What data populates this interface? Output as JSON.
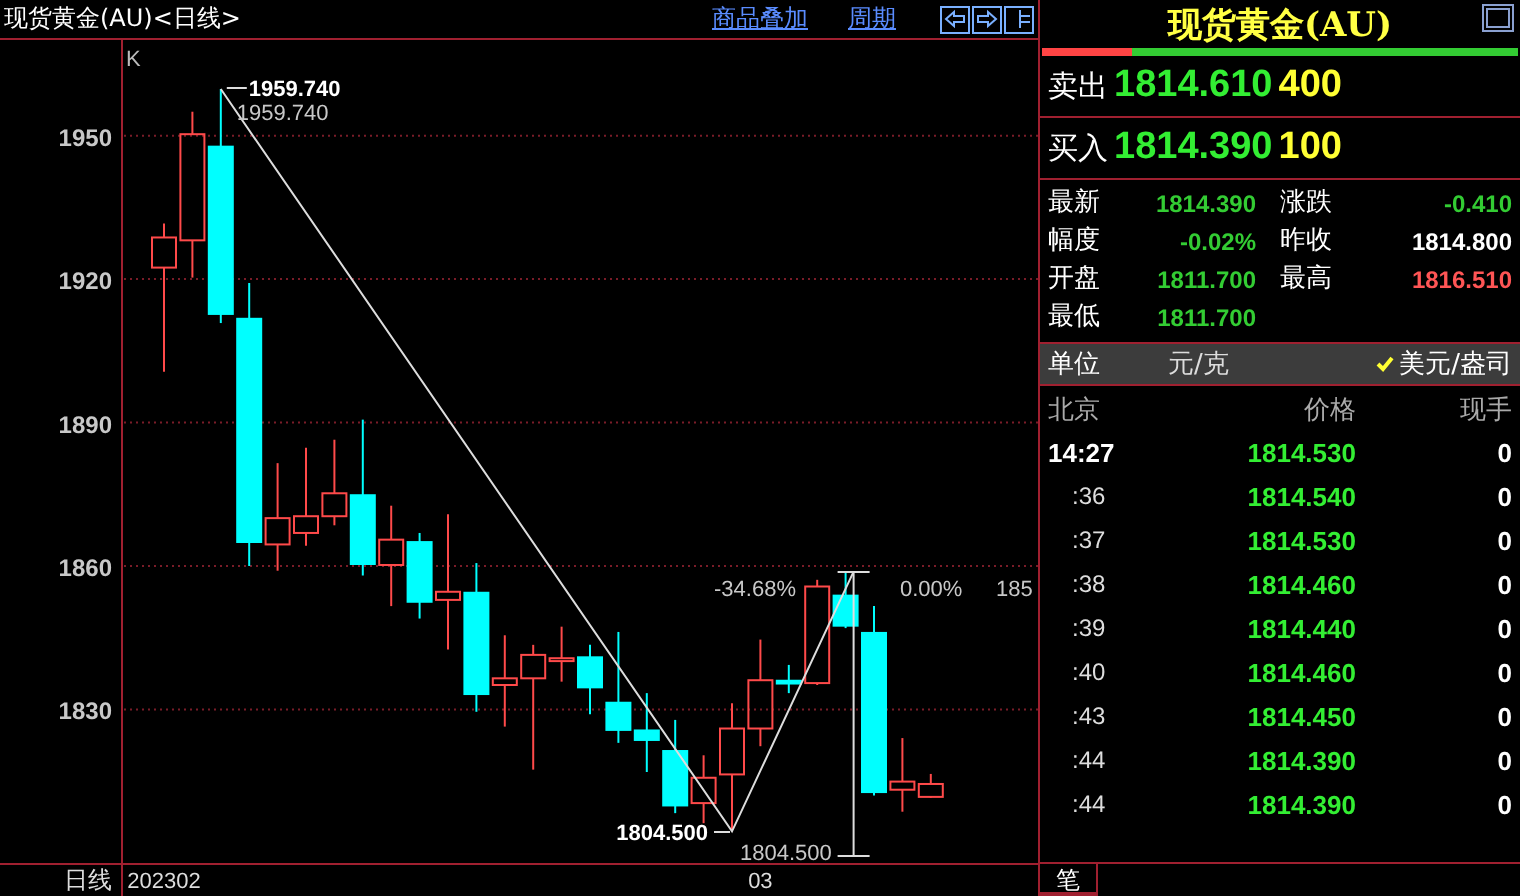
{
  "header": {
    "title": "现货黄金(AU)<日线>",
    "links": [
      "商品叠加",
      "周期"
    ]
  },
  "chart": {
    "corner_label": "K",
    "period_label": "日线",
    "chart_data": {
      "type": "candlestick",
      "ylim": [
        1798.5,
        1970
      ],
      "yticks": [
        1830,
        1860,
        1890,
        1920,
        1950
      ],
      "grid": true,
      "categories": [
        "202302",
        null,
        null,
        null,
        null,
        null,
        null,
        null,
        null,
        null,
        null,
        null,
        null,
        null,
        null,
        null,
        null,
        null,
        null,
        null,
        null,
        "03",
        null,
        null,
        null,
        null,
        null,
        null,
        null,
        null
      ],
      "ohlc": [
        [
          1922.4,
          1931.6,
          1900.6,
          1928.7
        ],
        [
          1928.1,
          1955,
          1920.3,
          1950.3
        ],
        [
          1947.9,
          1959.74,
          1910.8,
          1912.5
        ],
        [
          1911.9,
          1919.2,
          1860,
          1864.8
        ],
        [
          1864.5,
          1881.5,
          1859,
          1870
        ],
        [
          1866.9,
          1884.7,
          1864.2,
          1870.4
        ],
        [
          1870.4,
          1886.4,
          1868.5,
          1875.2
        ],
        [
          1875,
          1890.6,
          1858,
          1860.2
        ],
        [
          1860.2,
          1872.6,
          1851.6,
          1865.5
        ],
        [
          1865.2,
          1866.9,
          1849,
          1852.3
        ],
        [
          1852.9,
          1870.8,
          1842.5,
          1854.6
        ],
        [
          1854.6,
          1860.6,
          1829.5,
          1833
        ],
        [
          1835.1,
          1845.5,
          1826.4,
          1836.5
        ],
        [
          1836.5,
          1843.5,
          1817.4,
          1841.4
        ],
        [
          1840.1,
          1847.3,
          1835.8,
          1840.7
        ],
        [
          1841.1,
          1843.5,
          1829,
          1834.4
        ],
        [
          1831.6,
          1846.2,
          1823,
          1825.5
        ],
        [
          1825.8,
          1833.4,
          1816.9,
          1823.4
        ],
        [
          1821.5,
          1827.8,
          1808.3,
          1809.7
        ],
        [
          1810.4,
          1820.4,
          1806.2,
          1815.7
        ],
        [
          1816.4,
          1831.3,
          1804.5,
          1826
        ],
        [
          1826,
          1844.6,
          1822.3,
          1836.1
        ],
        [
          1836.2,
          1839.3,
          1833.4,
          1835.2
        ],
        [
          1835.5,
          1857.1,
          1835.1,
          1855.7
        ],
        [
          1854,
          1858.8,
          1847,
          1847.3
        ],
        [
          1846.2,
          1851.6,
          1812,
          1812.5
        ],
        [
          1813.2,
          1824,
          1808.6,
          1814.9
        ],
        [
          1811.7,
          1816.5,
          1811.5,
          1814.4
        ],
        null,
        null
      ],
      "annotations": [
        "1959.740",
        "1959.740",
        "1804.500",
        "1804.500",
        "-34.68%",
        "0.00%",
        "185"
      ]
    }
  },
  "quote": {
    "title": "现货黄金(AU)",
    "ratio": {
      "level": 0.19
    },
    "ask": {
      "label": "卖出",
      "price": "1814.610",
      "volume": "400"
    },
    "bid": {
      "label": "买入",
      "price": "1814.390",
      "volume": "100"
    },
    "stats": [
      {
        "label": "最新",
        "value": "1814.390",
        "color": "#33cc33"
      },
      {
        "label": "涨跌",
        "value": "-0.410",
        "color": "#33cc33"
      },
      {
        "label": "幅度",
        "value": "-0.02%",
        "color": "#33cc33"
      },
      {
        "label": "昨收",
        "value": "1814.800",
        "color": "#ffffff"
      },
      {
        "label": "开盘",
        "value": "1811.700",
        "color": "#33cc33"
      },
      {
        "label": "最高",
        "value": "1816.510",
        "color": "#ff5555"
      },
      {
        "label": "最低",
        "value": "1811.700",
        "color": "#33cc33"
      }
    ],
    "unit": {
      "label": "单位",
      "options": [
        {
          "text": "元/克",
          "selected": false
        },
        {
          "text": "美元/盎司",
          "selected": true
        }
      ]
    },
    "ticks": {
      "columns": [
        "北京",
        "价格",
        "现手"
      ],
      "rows": [
        {
          "kind": "hour",
          "time": "14:27",
          "price": "1814.530",
          "volume": "0"
        },
        {
          "kind": "minute",
          "time": ":36",
          "price": "1814.540",
          "volume": "0"
        },
        {
          "kind": "minute",
          "time": ":37",
          "price": "1814.530",
          "volume": "0"
        },
        {
          "kind": "minute",
          "time": ":38",
          "price": "1814.460",
          "volume": "0"
        },
        {
          "kind": "minute",
          "time": ":39",
          "price": "1814.440",
          "volume": "0"
        },
        {
          "kind": "minute",
          "time": ":40",
          "price": "1814.460",
          "volume": "0"
        },
        {
          "kind": "minute",
          "time": ":43",
          "price": "1814.450",
          "volume": "0"
        },
        {
          "kind": "minute",
          "time": ":44",
          "price": "1814.390",
          "volume": "0"
        },
        {
          "kind": "minute",
          "time": ":44",
          "price": "1814.390",
          "volume": "0"
        }
      ]
    },
    "tabs": [
      {
        "label": "笔",
        "selected": true
      }
    ]
  }
}
